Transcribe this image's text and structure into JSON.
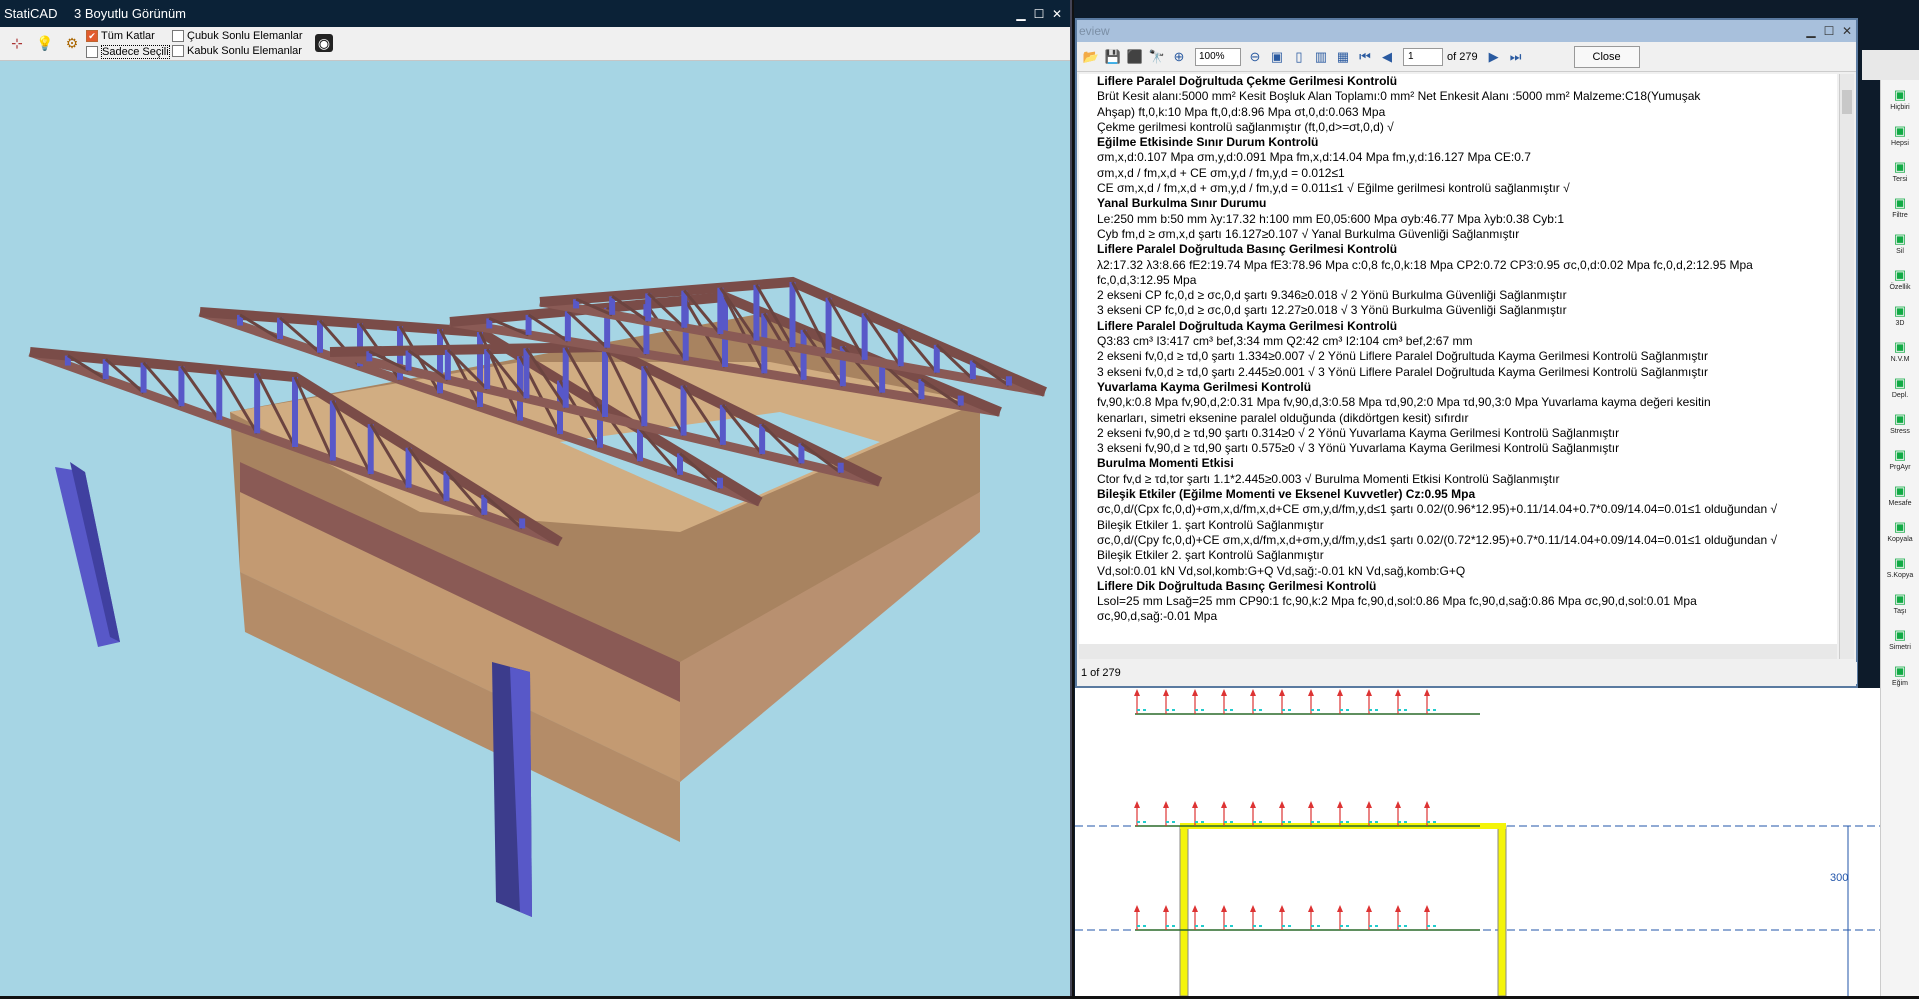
{
  "app": {
    "name": "StatiCAD",
    "view_title": "3 Boyutlu Görünüm"
  },
  "toolbar": {
    "all_floors": "Tüm Katlar",
    "selected_only": "Sadece Seçili",
    "bar_fe": "Çubuk Sonlu Elemanlar",
    "shell_fe": "Kabuk Sonlu Elemanlar"
  },
  "preview": {
    "title": "eview",
    "zoom": "100%",
    "page": "1",
    "of_pages": "of 279",
    "close": "Close",
    "status": "1 of 279"
  },
  "doc_lines": [
    {
      "t": "Liflere Paralel Doğrultuda Çekme Gerilmesi Kontrolü",
      "h": true
    },
    {
      "t": "Brüt Kesit alanı:5000 mm²   Kesit Boşluk Alan Toplamı:0 mm²   Net Enkesit Alanı :5000 mm²  Malzeme:C18(Yumuşak"
    },
    {
      "t": "Ahşap)  ft,0,k:10 Mpa  ft,0,d:8.96 Mpa  σt,0,d:0.063 Mpa"
    },
    {
      "t": "Çekme gerilmesi kontrolü sağlanmıştır (ft,0,d>=σt,0,d) √"
    },
    {
      "t": "Eğilme Etkisinde Sınır Durum Kontrolü",
      "h": true
    },
    {
      "t": "  σm,x,d:0.107 Mpa    σm,y,d:0.091 Mpa    fm,x,d:14.04 Mpa    fm,y,d:16.127 Mpa   CE:0.7"
    },
    {
      "t": "σm,x,d / fm,x,d + CE σm,y,d / fm,y,d = 0.012≤1"
    },
    {
      "t": "CE σm,x,d / fm,x,d + σm,y,d / fm,y,d = 0.011≤1  √ Eğilme gerilmesi kontrolü sağlanmıştır √"
    },
    {
      "t": "Yanal Burkulma Sınır Durumu",
      "h": true
    },
    {
      "t": "  Le:250 mm  b:50 mm  λy:17.32  h:100 mm  E0,05:600 Mpa  σyb:46.77 Mpa  λyb:0.38   Cyb:1"
    },
    {
      "t": "Cyb fm,d ≥ σm,x,d şartı 16.127≥0.107 √ Yanal Burkulma Güvenliği Sağlanmıştır"
    },
    {
      "t": "Liflere Paralel Doğrultuda Basınç Gerilmesi Kontrolü",
      "h": true
    },
    {
      "t": "λ2:17.32  λ3:8.66  fE2:19.74 Mpa  fE3:78.96 Mpa  c:0,8  fc,0,k:18 Mpa  CP2:0.72   CP3:0.95  σc,0,d:0.02 Mpa   fc,0,d,2:12.95 Mpa"
    },
    {
      "t": "  fc,0,d,3:12.95 Mpa"
    },
    {
      "t": "2 ekseni CP fc,0,d ≥ σc,0,d şartı  9.346≥0.018 √ 2 Yönü Burkulma Güvenliği Sağlanmıştır"
    },
    {
      "t": "3 ekseni CP fc,0,d ≥ σc,0,d şartı  12.27≥0.018 √ 3 Yönü Burkulma Güvenliği Sağlanmıştır"
    },
    {
      "t": "Liflere Paralel Doğrultuda Kayma Gerilmesi Kontrolü",
      "h": true
    },
    {
      "t": "Q3:83 cm³  I3:417 cm³   bef,3:34 mm   Q2:42 cm³  I2:104 cm³  bef,2:67 mm"
    },
    {
      "t": "2 ekseni fv,0,d  ≥ τd,0 şartı  1.334≥0.007 √ 2 Yönü Liflere Paralel Doğrultuda Kayma Gerilmesi Kontrolü Sağlanmıştır"
    },
    {
      "t": "3 ekseni fv,0,d  ≥ τd,0 şartı  2.445≥0.001 √ 3 Yönü Liflere Paralel Doğrultuda Kayma Gerilmesi Kontrolü Sağlanmıştır"
    },
    {
      "t": "Yuvarlama Kayma Gerilmesi Kontrolü",
      "h": true
    },
    {
      "t": "fv,90,k:0.8 Mpa  fv,90,d,2:0.31 Mpa   fv,90,d,3:0.58 Mpa      τd,90,2:0 Mpa      τd,90,3:0 Mpa Yuvarlama kayma değeri kesitin"
    },
    {
      "t": "kenarları, simetri eksenine paralel olduğunda (dikdörtgen kesit) sıfırdır"
    },
    {
      "t": "2 ekseni fv,90,d  ≥ τd,90 şartı  0.314≥0 √ 2 Yönü Yuvarlama Kayma Gerilmesi Kontrolü Sağlanmıştır"
    },
    {
      "t": "3 ekseni fv,90,d  ≥ τd,90 şartı  0.575≥0 √ 3 Yönü Yuvarlama Kayma Gerilmesi Kontrolü Sağlanmıştır"
    },
    {
      "t": "Burulma Momenti Etkisi",
      "h": true
    },
    {
      "t": "  Ctor fv,d  ≥  τd,tor şartı 1.1*2.445≥0.003 √ Burulma Momenti Etkisi Kontrolü Sağlanmıştır"
    },
    {
      "t": "Bileşik Etkiler (Eğilme Momenti ve Eksenel Kuvvetler) Cz:0.95 Mpa",
      "h": true
    },
    {
      "t": "σc,0,d/(Cpx fc,0,d)+σm,x,d/fm,x,d+CE σm,y,d/fm,y,d≤1 şartı  0.02/(0.96*12.95)+0.11/14.04+0.7*0.09/14.04=0.01≤1 olduğundan √"
    },
    {
      "t": "Bileşik Etkiler 1. şart Kontrolü Sağlanmıştır"
    },
    {
      "t": "σc,0,d/(Cpy fc,0,d)+CE σm,x,d/fm,x,d+σm,y,d/fm,y,d≤1 şartı  0.02/(0.72*12.95)+0.7*0.11/14.04+0.09/14.04=0.01≤1 olduğundan √"
    },
    {
      "t": "Bileşik Etkiler 2. şart Kontrolü Sağlanmıştır"
    },
    {
      "t": " "
    },
    {
      "t": "Vd,sol:0.01 kN    Vd,sol,komb:G+Q  Vd,sağ:-0.01 kN   Vd,sağ,komb:G+Q"
    },
    {
      "t": "Liflere Dik Doğrultuda Basınç Gerilmesi Kontrolü",
      "h": true
    },
    {
      "t": "Lsol=25 mm Lsağ=25 mm CP90:1 fc,90,k:2 Mpa fc,90,d,sol:0.86 Mpa   fc,90,d,sağ:0.86 Mpa     σc,90,d,sol:0.01 Mpa"
    },
    {
      "t": "σc,90,d,sağ:-0.01 Mpa"
    }
  ],
  "right_tools": [
    {
      "label": "Hiçbiri",
      "icon": "select-icon"
    },
    {
      "label": "Hepsi",
      "icon": "select-all-icon"
    },
    {
      "label": "Tersi",
      "icon": "invert-icon"
    },
    {
      "label": "Filtre",
      "icon": "filter-icon"
    },
    {
      "label": "Sil",
      "icon": "delete-icon"
    },
    {
      "label": "Özellik",
      "icon": "properties-icon"
    },
    {
      "label": "3D",
      "icon": "3d-icon"
    },
    {
      "label": "N.V.M",
      "icon": "nvm-icon"
    },
    {
      "label": "Depl.",
      "icon": "displacement-icon"
    },
    {
      "label": "Stress",
      "icon": "stress-icon"
    },
    {
      "label": "PrgAyr",
      "icon": "settings-icon"
    },
    {
      "label": "Mesafe",
      "icon": "distance-icon"
    },
    {
      "label": "Kopyala",
      "icon": "copy-icon"
    },
    {
      "label": "S.Kopya",
      "icon": "special-copy-icon"
    },
    {
      "label": "Taşı",
      "icon": "move-icon"
    },
    {
      "label": "Simetri",
      "icon": "mirror-icon"
    },
    {
      "label": "Eğim",
      "icon": "slope-icon"
    }
  ],
  "drawing": {
    "dim_label": "300"
  },
  "colors": {
    "sky": "#a6d5e4",
    "wall": "#c39a72",
    "truss": "#8a5a55",
    "post": "#5858c8",
    "sel": "#f4f40a"
  }
}
